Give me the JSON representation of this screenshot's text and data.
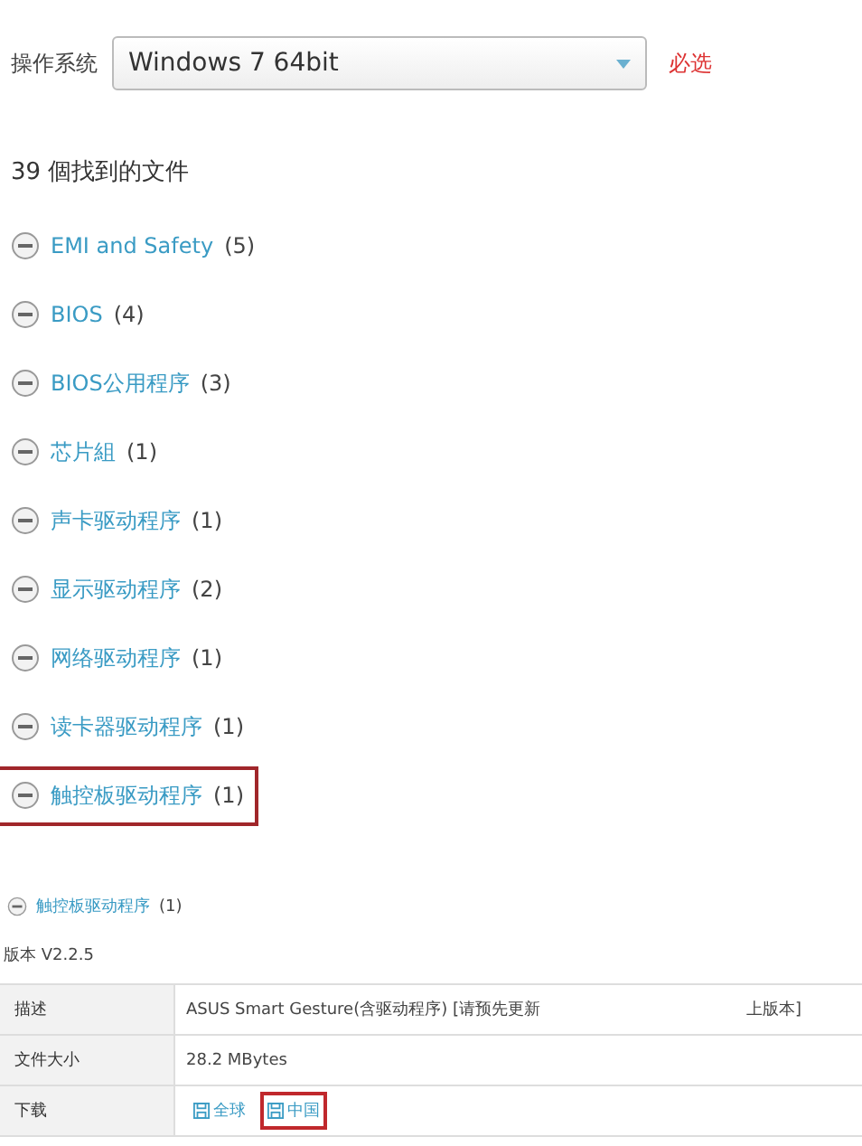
{
  "os_filter": {
    "label": "操作系统",
    "value": "Windows 7 64bit",
    "required_note": "必选"
  },
  "result_count": "39 個找到的文件",
  "categories": [
    {
      "name": "EMI and Safety",
      "count": "(5)",
      "highlighted": false
    },
    {
      "name": "BIOS",
      "count": "(4)",
      "highlighted": false
    },
    {
      "name": "BIOS公用程序",
      "count": "(3)",
      "highlighted": false
    },
    {
      "name": "芯片組",
      "count": "(1)",
      "highlighted": false
    },
    {
      "name": "声卡驱动程序",
      "count": "(1)",
      "highlighted": false
    },
    {
      "name": "显示驱动程序",
      "count": "(2)",
      "highlighted": false
    },
    {
      "name": "网络驱动程序",
      "count": "(1)",
      "highlighted": false
    },
    {
      "name": "读卡器驱动程序",
      "count": "(1)",
      "highlighted": false
    },
    {
      "name": "触控板驱动程序",
      "count": "(1)",
      "highlighted": true
    }
  ],
  "expanded_section": {
    "name": "触控板驱动程序",
    "count": "(1)",
    "version": "版本 V2.2.5",
    "rows": [
      {
        "kind": "text",
        "label": "描述",
        "value": "ASUS Smart Gesture(含驱动程序) [请预先更新",
        "value_end": "上版本]"
      },
      {
        "kind": "text",
        "label": "文件大小",
        "value": "28.2 MBytes"
      },
      {
        "kind": "links",
        "label": "下载",
        "links": [
          {
            "text": "全球",
            "highlighted": false
          },
          {
            "text": "中国",
            "highlighted": true
          }
        ]
      }
    ]
  }
}
